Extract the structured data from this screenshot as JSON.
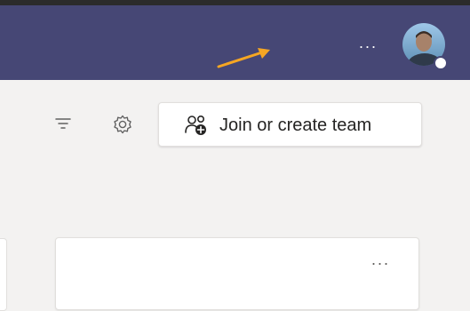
{
  "titlebar": {
    "more_label": "···",
    "avatar_icon": "user-avatar",
    "status_icon": "status-dot-icon",
    "background_color": "#464775"
  },
  "annotation": {
    "arrow_icon": "arrow-icon",
    "color": "#f5a623"
  },
  "toolbar": {
    "filter_icon": "filter-icon",
    "settings_icon": "gear-icon",
    "join_button_icon": "people-add-icon",
    "join_button_label": "Join or create team"
  },
  "team_card": {
    "more_label": "···"
  }
}
